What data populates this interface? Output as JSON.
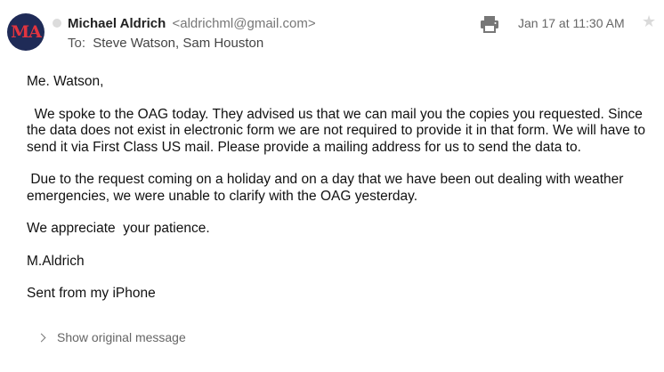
{
  "message": {
    "avatar": {
      "initials": "MA",
      "bg_color": "#1f2b57",
      "text_color": "#e2343f"
    },
    "sender": {
      "name": "Michael Aldrich",
      "email": "<aldrichml@gmail.com>"
    },
    "to": {
      "label": "To:",
      "recipients": "Steve Watson,  Sam Houston"
    },
    "date": "Jan 17 at 11:30 AM",
    "icons": {
      "print": "print-icon",
      "star": "star-icon",
      "status": "status-dot"
    },
    "body": {
      "greeting": "Me. Watson,",
      "paragraph1": "  We spoke to the OAG today. They advised us that we can mail you the copies you requested. Since the data does not exist in electronic form we are not required to provide it in that form. We will have to send it via First Class US mail. Please provide a mailing address for us to send the data to.",
      "paragraph2": " Due to the request coming on a holiday and on a day that we have been out dealing with weather emergencies, we were unable to clarify with the OAG yesterday.",
      "thanks": "We appreciate  your patience.",
      "signature": "M.Aldrich",
      "footer": "Sent from my iPhone"
    },
    "show_original": "Show original message"
  }
}
